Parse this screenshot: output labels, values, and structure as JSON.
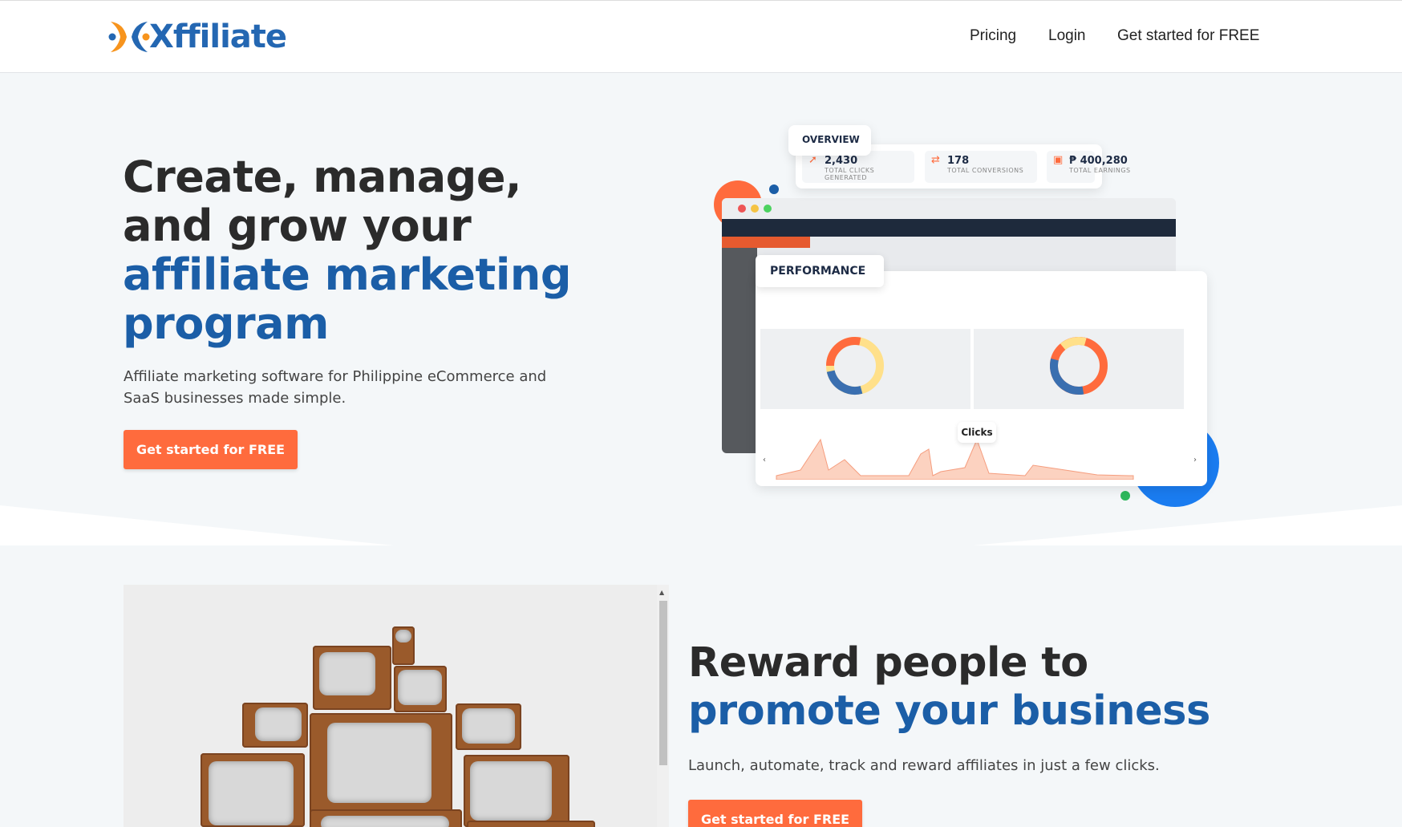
{
  "brand": {
    "name": "Xffiliate",
    "colors": {
      "primary": "#1b5ea7",
      "accent": "#ff6b3d",
      "dark": "#2b2b2b"
    }
  },
  "nav": {
    "pricing": "Pricing",
    "login": "Login",
    "cta": "Get started for FREE"
  },
  "hero": {
    "title_line1": "Create, manage,",
    "title_line2": "and grow your",
    "title_line3": "affiliate marketing",
    "title_line4": "program",
    "subtitle": "Affiliate marketing software for Philippine eCommerce and SaaS businesses made simple.",
    "cta": "Get started for FREE"
  },
  "dashboard": {
    "overview_tab": "OVERVIEW",
    "stats": [
      {
        "icon": "cursor-icon",
        "value": "2,430",
        "label": "TOTAL CLICKS GENERATED"
      },
      {
        "icon": "repeat-icon",
        "value": "178",
        "label": "TOTAL CONVERSIONS"
      },
      {
        "icon": "money-icon",
        "value": "₱ 400,280",
        "label": "TOTAL EARNINGS"
      }
    ],
    "performance_tab": "PERFORMANCE",
    "clicks_label": "Clicks"
  },
  "section2": {
    "title_line1": "Reward people to",
    "title_line2": "promote your business",
    "subtitle": "Launch, automate, track and reward affiliates in just a few clicks.",
    "cta": "Get started for FREE"
  }
}
